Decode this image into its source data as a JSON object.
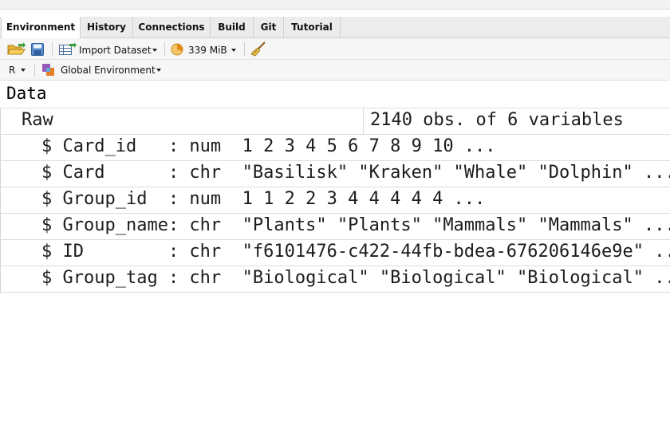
{
  "tabs": [
    {
      "label": "Environment",
      "active": true
    },
    {
      "label": "History",
      "active": false
    },
    {
      "label": "Connections",
      "active": false
    },
    {
      "label": "Build",
      "active": false
    },
    {
      "label": "Git",
      "active": false
    },
    {
      "label": "Tutorial",
      "active": false
    }
  ],
  "toolbar": {
    "open_icon": "folder-open-icon",
    "save_icon": "save-icon",
    "import_label": "Import Dataset",
    "memory_label": "339 MiB",
    "clear_icon": "broom-icon"
  },
  "env_bar": {
    "language": "R",
    "environment": "Global Environment"
  },
  "section_title": "Data",
  "object": {
    "name": "Raw",
    "summary": "2140 obs. of 6 variables"
  },
  "variables": [
    {
      "line": "$ Card_id   : num  1 2 3 4 5 6 7 8 9 10 ..."
    },
    {
      "line": "$ Card      : chr  \"Basilisk\" \"Kraken\" \"Whale\" \"Dolphin\" ..."
    },
    {
      "line": "$ Group_id  : num  1 1 2 2 3 4 4 4 4 4 ..."
    },
    {
      "line": "$ Group_name: chr  \"Plants\" \"Plants\" \"Mammals\" \"Mammals\" ..."
    },
    {
      "line": "$ ID        : chr  \"f6101476-c422-44fb-bdea-676206146e9e\" ..."
    },
    {
      "line": "$ Group_tag : chr  \"Biological\" \"Biological\" \"Biological\" ..."
    }
  ],
  "colors": {
    "tab_bar": "#ececec",
    "toolbar": "#f6f6f6",
    "expand_icon": "#4a7fd6"
  }
}
